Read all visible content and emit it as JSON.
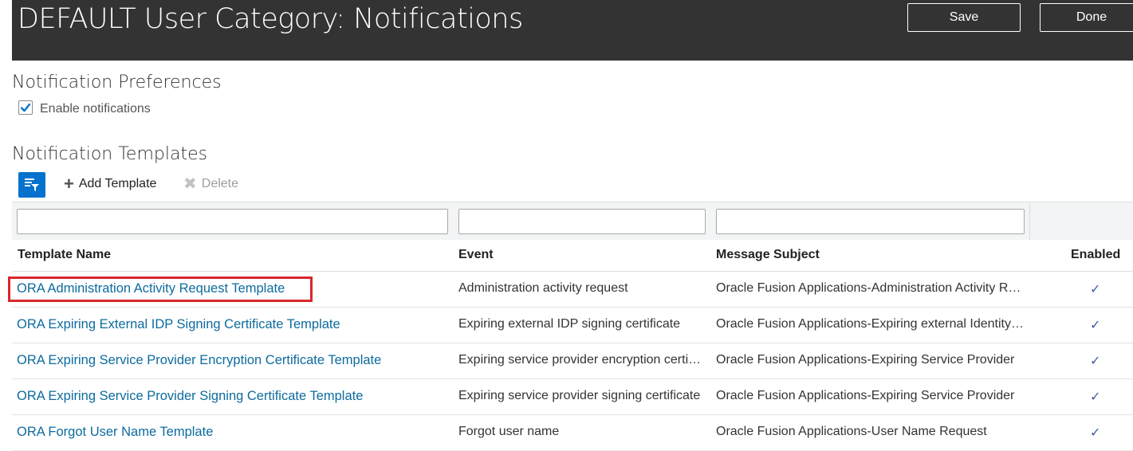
{
  "header": {
    "title": "DEFAULT User Category: Notifications",
    "save_label": "Save",
    "done_label": "Done"
  },
  "preferences": {
    "title": "Notification Preferences",
    "enable_label": "Enable notifications",
    "enable_checked": true
  },
  "templates": {
    "title": "Notification Templates",
    "add_label": "Add Template",
    "delete_label": "Delete",
    "columns": {
      "name": "Template Name",
      "event": "Event",
      "subject": "Message Subject",
      "enabled": "Enabled"
    },
    "rows": [
      {
        "name": "ORA Administration Activity Request Template",
        "event": "Administration activity request",
        "subject": "Oracle Fusion Applications-Administration Activity Request",
        "enabled": "✓"
      },
      {
        "name": "ORA Expiring External IDP Signing Certificate Template",
        "event": "Expiring external IDP signing certificate",
        "subject": "Oracle Fusion Applications-Expiring external Identity Provider",
        "enabled": "✓"
      },
      {
        "name": "ORA Expiring Service Provider Encryption Certificate Template",
        "event": "Expiring service provider encryption certificate",
        "subject": "Oracle Fusion Applications-Expiring Service Provider",
        "enabled": "✓"
      },
      {
        "name": "ORA Expiring Service Provider Signing Certificate Template",
        "event": "Expiring service provider signing certificate",
        "subject": "Oracle Fusion Applications-Expiring Service Provider",
        "enabled": "✓"
      },
      {
        "name": "ORA Forgot User Name Template",
        "event": "Forgot user name",
        "subject": "Oracle Fusion Applications-User Name Request",
        "enabled": "✓"
      }
    ]
  },
  "colors": {
    "header_bg": "#333333",
    "link": "#0d6b9e",
    "accent": "#0572ce",
    "highlight": "#d9272e"
  }
}
